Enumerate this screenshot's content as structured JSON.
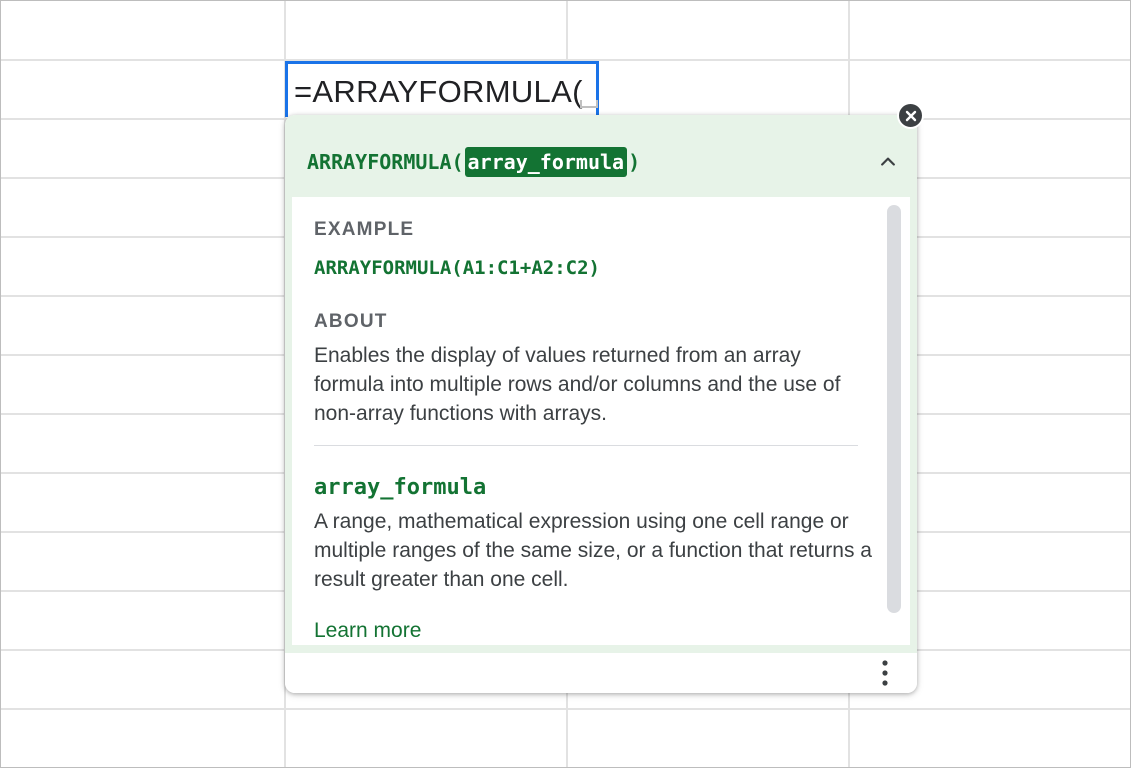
{
  "cell": {
    "formula_text": "=ARRAYFORMULA("
  },
  "help": {
    "signature": {
      "function_name": "ARRAYFORMULA",
      "open_paren": "(",
      "param": "array_formula",
      "close_paren": ")"
    },
    "example": {
      "title": "EXAMPLE",
      "code": "ARRAYFORMULA(A1:C1+A2:C2)"
    },
    "about": {
      "title": "ABOUT",
      "text": "Enables the display of values returned from an array formula into multiple rows and/or columns and the use of non-array functions with arrays."
    },
    "parameter": {
      "name": "array_formula",
      "description": "A range, mathematical expression using one cell range or multiple ranges of the same size, or a function that returns a result greater than one cell."
    },
    "learn_more_label": "Learn more"
  },
  "icons": {
    "collapse": "chevron-up-icon",
    "close": "close-circle-icon",
    "more": "more-vert-icon"
  },
  "colors": {
    "accent_green": "#137333",
    "header_tint": "#e7f3e8",
    "cell_border": "#1a73e8",
    "grid_line": "#e2e2e2"
  }
}
